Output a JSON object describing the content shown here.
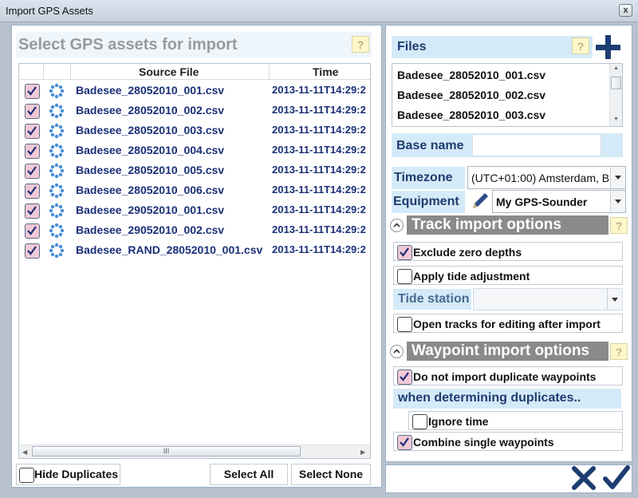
{
  "window": {
    "title": "Import GPS Assets",
    "close": "x"
  },
  "left": {
    "heading": "Select GPS assets for import",
    "help": "?",
    "columns": {
      "source": "Source File",
      "time": "Time"
    },
    "rows": [
      {
        "file": "Badesee_28052010_001.csv",
        "time": "2013-11-11T14:29:2"
      },
      {
        "file": "Badesee_28052010_002.csv",
        "time": "2013-11-11T14:29:2"
      },
      {
        "file": "Badesee_28052010_003.csv",
        "time": "2013-11-11T14:29:2"
      },
      {
        "file": "Badesee_28052010_004.csv",
        "time": "2013-11-11T14:29:2"
      },
      {
        "file": "Badesee_28052010_005.csv",
        "time": "2013-11-11T14:29:2"
      },
      {
        "file": "Badesee_28052010_006.csv",
        "time": "2013-11-11T14:29:2"
      },
      {
        "file": "Badesee_29052010_001.csv",
        "time": "2013-11-11T14:29:2"
      },
      {
        "file": "Badesee_29052010_002.csv",
        "time": "2013-11-11T14:29:2"
      },
      {
        "file": "Badesee_RAND_28052010_001.csv",
        "time": "2013-11-11T14:29:2"
      }
    ],
    "hide_duplicates": "Hide Duplicates",
    "select_all": "Select All",
    "select_none": "Select None",
    "scroll_grip": "III"
  },
  "right": {
    "files_label": "Files",
    "help": "?",
    "files": [
      "Badesee_28052010_001.csv",
      "Badesee_28052010_002.csv",
      "Badesee_28052010_003.csv"
    ],
    "base_name_label": "Base name",
    "base_name_value": "",
    "timezone_label": "Timezone",
    "timezone_value": "(UTC+01:00) Amsterdam, B",
    "equipment_label": "Equipment",
    "equipment_value": "My GPS-Sounder",
    "track_header": "Track import options",
    "exclude_zero": "Exclude zero depths",
    "apply_tide": "Apply tide adjustment",
    "tide_station_label": "Tide station",
    "open_tracks": "Open tracks for editing after import",
    "waypoint_header": "Waypoint import options",
    "no_duplicates": "Do not import duplicate waypoints",
    "when_determining": "when determining duplicates..",
    "ignore_time": "Ignore time",
    "combine_single": "Combine single waypoints"
  },
  "colors": {
    "accent": "#1d3c70",
    "check_bg": "#f1c9d6",
    "section": "#8a8a8a",
    "label_bg": "#d5eaf8"
  }
}
